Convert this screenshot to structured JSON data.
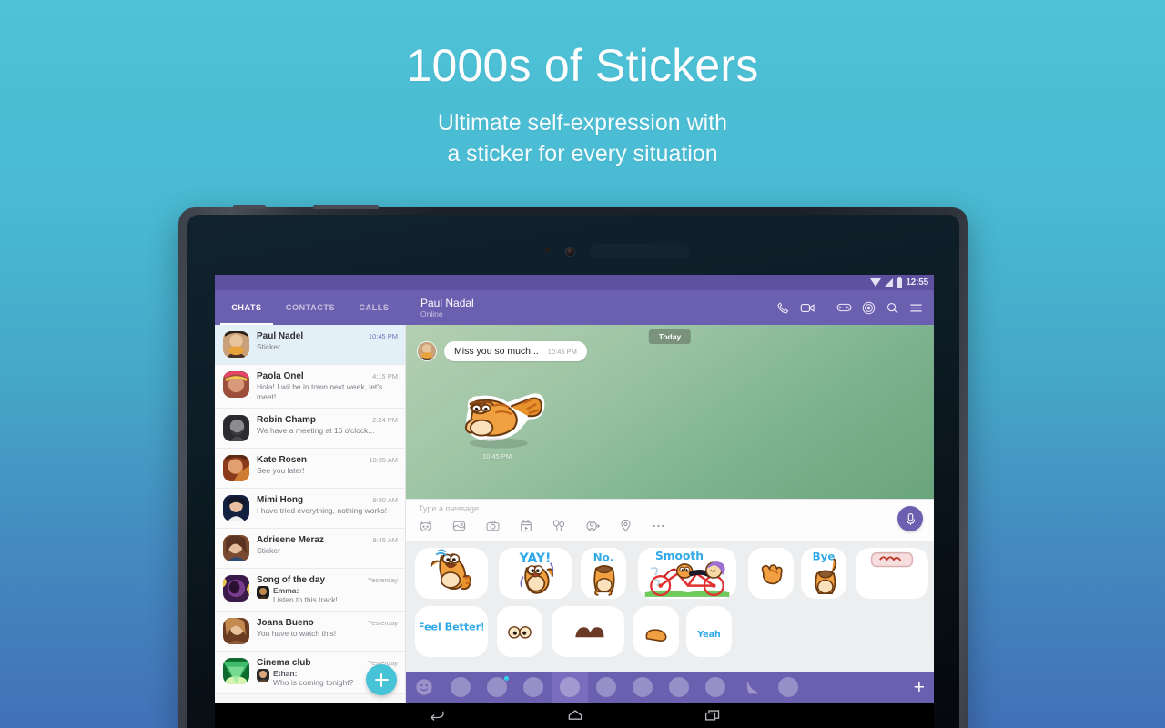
{
  "promo": {
    "title": "1000s of Stickers",
    "subtitle_line1": "Ultimate self-expression with",
    "subtitle_line2": "a sticker for every situation"
  },
  "device": {
    "status_bar": {
      "time": "12:55",
      "wifi_icon": "wifi-icon",
      "signal_icon": "signal-icon",
      "battery_icon": "battery-icon"
    },
    "nav_bar": {
      "back": "back-icon",
      "home": "home-icon",
      "recents": "recents-icon"
    }
  },
  "appbar": {
    "tabs": [
      {
        "label": "CHATS",
        "active": true
      },
      {
        "label": "CONTACTS",
        "active": false
      },
      {
        "label": "CALLS",
        "active": false
      }
    ],
    "conversation_name": "Paul Nadal",
    "conversation_status": "Online",
    "actions": [
      "call-icon",
      "video-call-icon",
      "games-icon",
      "viber-out-icon",
      "search-icon",
      "menu-icon"
    ]
  },
  "chat_list": {
    "items": [
      {
        "name": "Paul Nadel",
        "preview": "Sticker",
        "time": "10:45 PM",
        "selected": true,
        "avatar_colors": [
          "#c9a07a",
          "#6b4632"
        ]
      },
      {
        "name": "Paola Onel",
        "preview": "Hola! I wil be in town next week, let's meet!",
        "time": "4:15 PM",
        "selected": false,
        "avatar_colors": [
          "#e8456b",
          "#9c4f3a"
        ]
      },
      {
        "name": "Robin Champ",
        "preview": "We have a meeting at 16 o'clock...",
        "time": "2:24 PM",
        "selected": false,
        "avatar_colors": [
          "#6e6e70",
          "#2b2b2d"
        ]
      },
      {
        "name": "Kate Rosen",
        "preview": "See you later!",
        "time": "10:35 AM",
        "selected": false,
        "avatar_colors": [
          "#e07a3c",
          "#8c3a1c"
        ]
      },
      {
        "name": "Mimi Hong",
        "preview": "I have tried everything, nothing works!",
        "time": "9:30 AM",
        "selected": false,
        "avatar_colors": [
          "#2a3f7a",
          "#14203f"
        ]
      },
      {
        "name": "Adrieene Meraz",
        "preview": "Sticker",
        "time": "8:45 AM",
        "selected": false,
        "avatar_colors": [
          "#d4a07c",
          "#7a4a30"
        ]
      },
      {
        "name": "Song of the day",
        "group_sender": "Emma:",
        "preview": "Listen to this track!",
        "time": "Yesterday",
        "selected": false,
        "avatar_colors": [
          "#7a3c8c",
          "#3a1a48"
        ]
      },
      {
        "name": "Joana Bueno",
        "preview": "You have to watch this!",
        "time": "Yesterday",
        "selected": false,
        "avatar_colors": [
          "#c4894f",
          "#6b3c22"
        ]
      },
      {
        "name": "Cinema club",
        "group_sender": "Ethan:",
        "preview": "Who is coming tonight?",
        "time": "Yesterday",
        "selected": false,
        "avatar_colors": [
          "#4cd07a",
          "#0d6b2e"
        ]
      }
    ],
    "new_chat_button": "+"
  },
  "conversation": {
    "day_badge": "Today",
    "message_text": "Miss you so much...",
    "message_time": "10:45 PM",
    "sticker_time": "10:45 PM"
  },
  "input_bar": {
    "placeholder": "Type a message...",
    "icons": [
      "sticker-icon",
      "image-icon",
      "camera-icon",
      "video-icon",
      "gift-icon",
      "contact-icon",
      "location-icon",
      "more-icon"
    ],
    "mic_button": "mic-icon"
  },
  "sticker_panel": {
    "row1": [
      {
        "kind": "cat",
        "label": "",
        "width": "normal"
      },
      {
        "kind": "cat",
        "label": "YAY!",
        "width": "normal"
      },
      {
        "kind": "cat",
        "label": "No.",
        "width": "small"
      },
      {
        "kind": "cat",
        "label": "Smooth",
        "width": "wide"
      },
      {
        "kind": "hand",
        "label": "",
        "width": "small"
      },
      {
        "kind": "cat",
        "label": "Bye",
        "width": "small"
      }
    ],
    "row2": [
      {
        "kind": "cat",
        "label": "",
        "width": "normal"
      },
      {
        "kind": "cat",
        "label": "Feel Better!",
        "width": "normal"
      },
      {
        "kind": "cat",
        "label": "",
        "width": "small"
      },
      {
        "kind": "cat",
        "label": "",
        "width": "normal"
      },
      {
        "kind": "hand",
        "label": "",
        "width": "small"
      },
      {
        "kind": "cat",
        "label": "Yeah",
        "width": "small"
      }
    ],
    "tabs": [
      {
        "icon": "smiley-icon",
        "active": false,
        "badge": false
      },
      {
        "icon": "character-girl-icon",
        "active": false,
        "badge": false
      },
      {
        "icon": "character-laugh-icon",
        "active": false,
        "badge": true
      },
      {
        "icon": "character-cap-icon",
        "active": false,
        "badge": false
      },
      {
        "icon": "character-cat-icon",
        "active": true,
        "badge": false
      },
      {
        "icon": "character-longhair-icon",
        "active": false,
        "badge": false
      },
      {
        "icon": "character-bean-icon",
        "active": false,
        "badge": false
      },
      {
        "icon": "character-monster-icon",
        "active": false,
        "badge": false
      },
      {
        "icon": "character-couple-icon",
        "active": false,
        "badge": false
      },
      {
        "icon": "shoe-icon",
        "active": false,
        "badge": false
      },
      {
        "icon": "character-curly-icon",
        "active": false,
        "badge": false
      }
    ],
    "add_button": "+"
  }
}
